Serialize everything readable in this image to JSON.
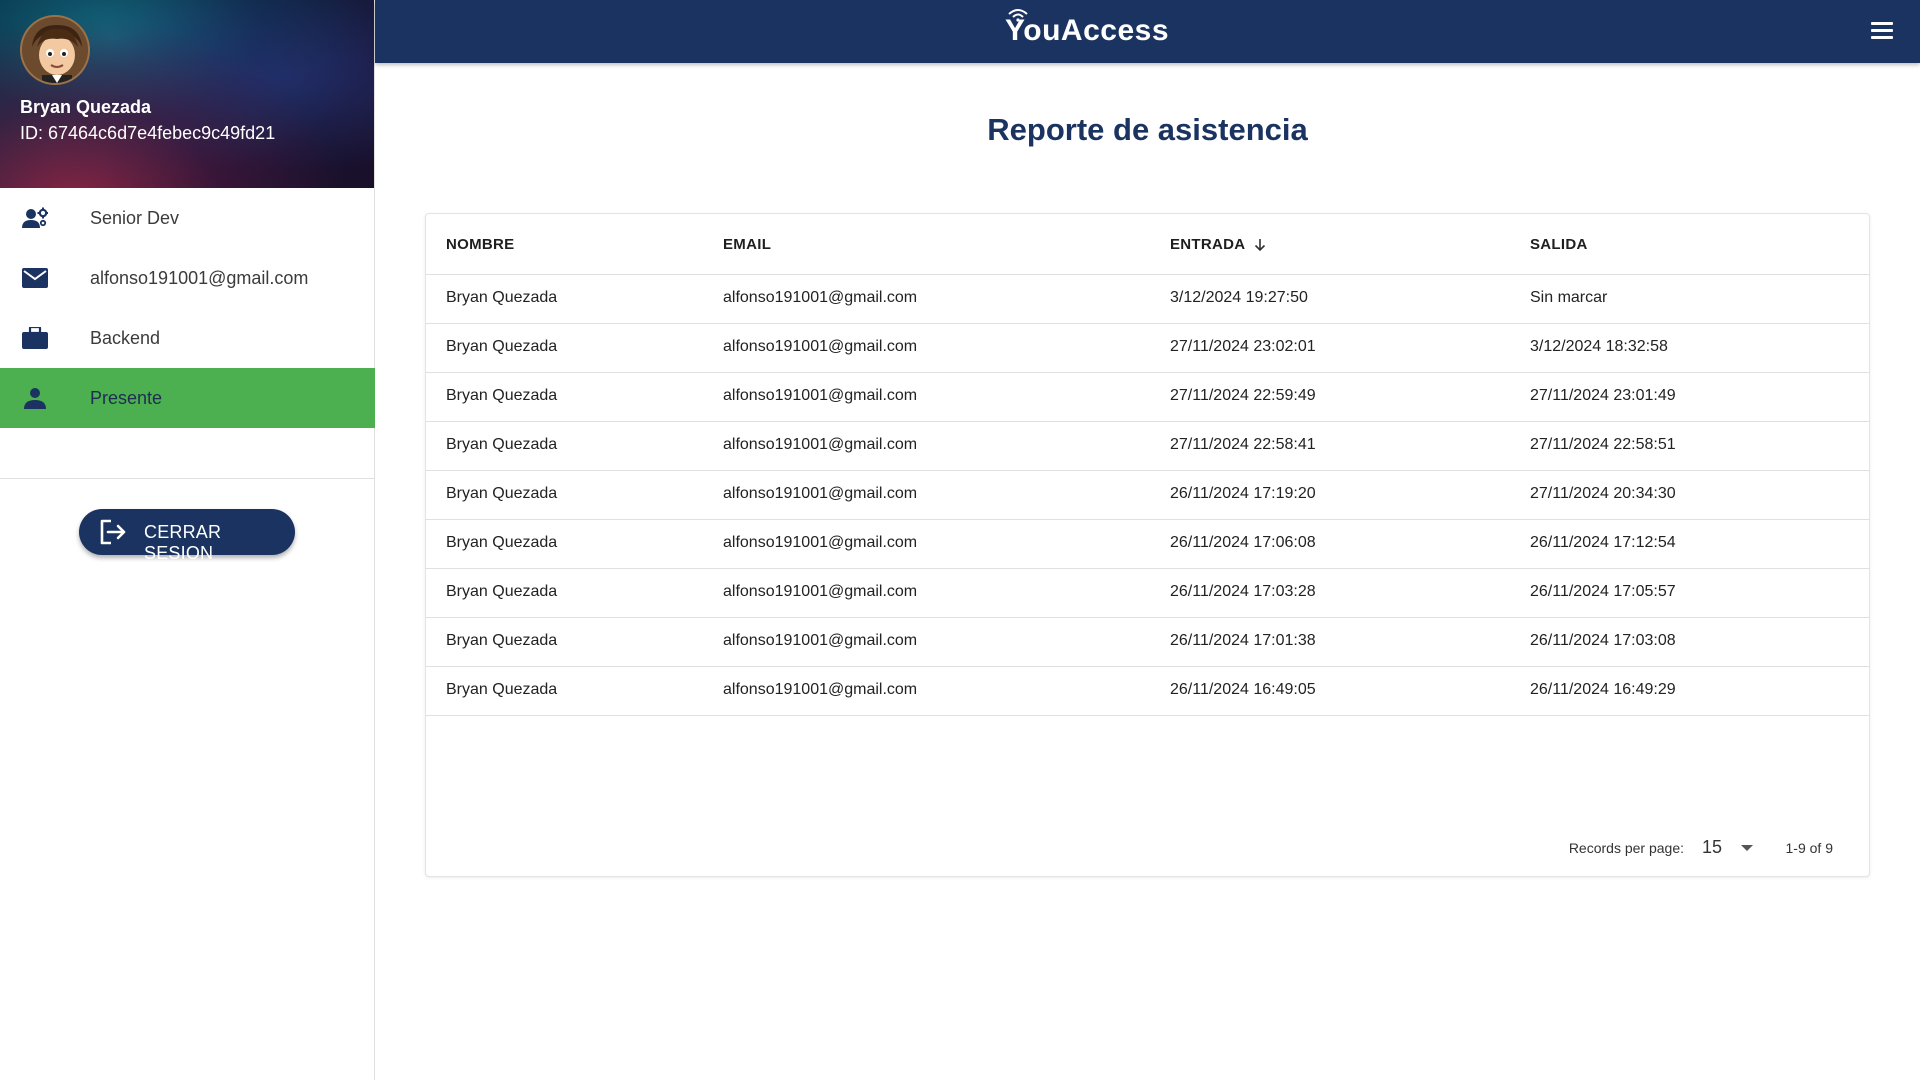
{
  "profile": {
    "name": "Bryan Quezada",
    "id_text": "ID: 67464c6d7e4febec9c49fd21"
  },
  "sidebar": {
    "items": [
      {
        "label": "Senior Dev",
        "icon": "user-gear-icon"
      },
      {
        "label": "alfonso191001@gmail.com",
        "icon": "mail-icon"
      },
      {
        "label": "Backend",
        "icon": "briefcase-icon"
      },
      {
        "label": "Presente",
        "icon": "person-icon",
        "active": true
      }
    ],
    "logout_label": "CERRAR SESION"
  },
  "header": {
    "brand": "YouAccess",
    "menu_icon": "hamburger-menu-icon"
  },
  "main": {
    "title": "Reporte de asistencia"
  },
  "table": {
    "columns": [
      "NOMBRE",
      "EMAIL",
      "ENTRADA",
      "SALIDA"
    ],
    "sorted_column": "ENTRADA",
    "sort_direction": "desc",
    "rows": [
      [
        "Bryan Quezada",
        "alfonso191001@gmail.com",
        "3/12/2024 19:27:50",
        "Sin marcar"
      ],
      [
        "Bryan Quezada",
        "alfonso191001@gmail.com",
        "27/11/2024 23:02:01",
        "3/12/2024 18:32:58"
      ],
      [
        "Bryan Quezada",
        "alfonso191001@gmail.com",
        "27/11/2024 22:59:49",
        "27/11/2024 23:01:49"
      ],
      [
        "Bryan Quezada",
        "alfonso191001@gmail.com",
        "27/11/2024 22:58:41",
        "27/11/2024 22:58:51"
      ],
      [
        "Bryan Quezada",
        "alfonso191001@gmail.com",
        "26/11/2024 17:19:20",
        "27/11/2024 20:34:30"
      ],
      [
        "Bryan Quezada",
        "alfonso191001@gmail.com",
        "26/11/2024 17:06:08",
        "26/11/2024 17:12:54"
      ],
      [
        "Bryan Quezada",
        "alfonso191001@gmail.com",
        "26/11/2024 17:03:28",
        "26/11/2024 17:05:57"
      ],
      [
        "Bryan Quezada",
        "alfonso191001@gmail.com",
        "26/11/2024 17:01:38",
        "26/11/2024 17:03:08"
      ],
      [
        "Bryan Quezada",
        "alfonso191001@gmail.com",
        "26/11/2024 16:49:05",
        "26/11/2024 16:49:29"
      ]
    ],
    "footer": {
      "records_per_page_label": "Records per page:",
      "records_per_page_value": "15",
      "range_text": "1-9 of 9"
    }
  },
  "colors": {
    "primary": "#1b3360",
    "active_item": "#4caf50"
  }
}
